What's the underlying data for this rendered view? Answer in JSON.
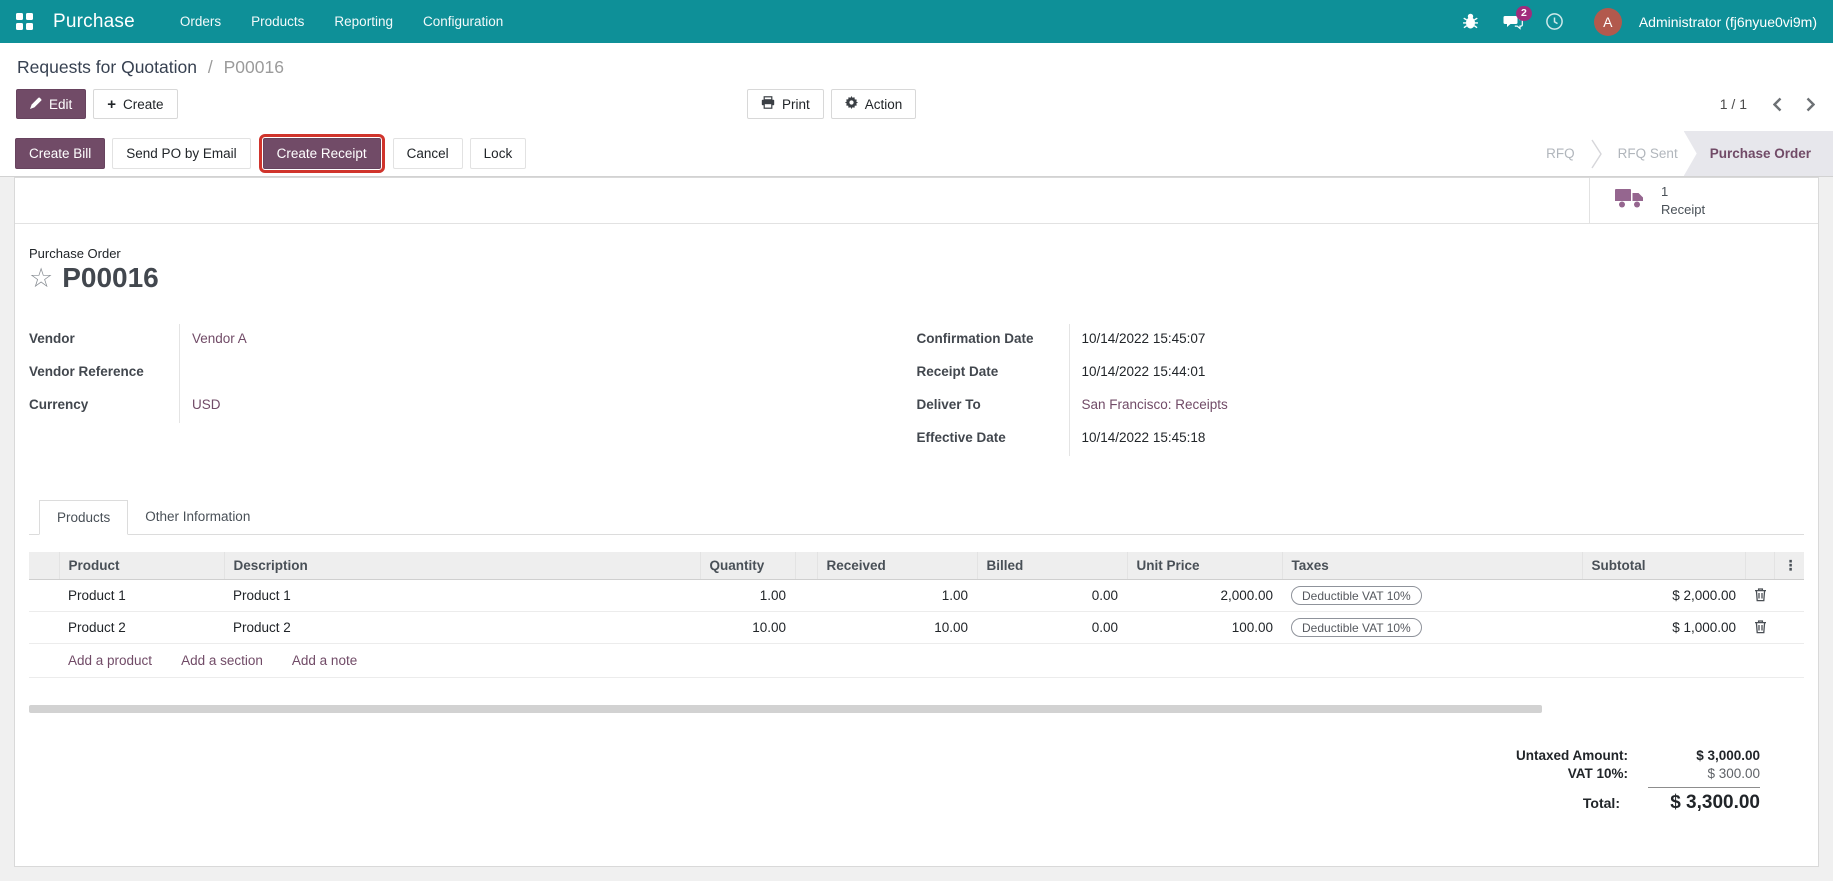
{
  "navbar": {
    "app_menu_label": "Purchase",
    "menus": [
      "Orders",
      "Products",
      "Reporting",
      "Configuration"
    ],
    "message_count": "2",
    "avatar_initial": "A",
    "user": "Administrator (fj6nyue0vi9m)"
  },
  "breadcrumb": {
    "parent": "Requests for Quotation",
    "separator": "/",
    "current": "P00016"
  },
  "actions": {
    "edit": "Edit",
    "create": "Create",
    "print": "Print",
    "action": "Action",
    "pager": "1 / 1"
  },
  "statusbar": {
    "buttons": [
      {
        "label": "Create Bill",
        "style": "primary"
      },
      {
        "label": "Send PO by Email",
        "style": "secondary"
      },
      {
        "label": "Create Receipt",
        "style": "primary",
        "highlighted": true
      },
      {
        "label": "Cancel",
        "style": "secondary"
      },
      {
        "label": "Lock",
        "style": "secondary"
      }
    ],
    "states": [
      {
        "label": "RFQ",
        "active": false
      },
      {
        "label": "RFQ Sent",
        "active": false
      },
      {
        "label": "Purchase Order",
        "active": true
      }
    ]
  },
  "smart_button": {
    "count": "1",
    "label": "Receipt"
  },
  "form": {
    "type_label": "Purchase Order",
    "name": "P00016",
    "left_fields": [
      {
        "label": "Vendor",
        "value": "Vendor A"
      },
      {
        "label": "Vendor Reference",
        "value": ""
      },
      {
        "label": "Currency",
        "value": "USD"
      }
    ],
    "right_fields": [
      {
        "label": "Confirmation Date",
        "value": "10/14/2022 15:45:07"
      },
      {
        "label": "Receipt Date",
        "value": "10/14/2022 15:44:01"
      },
      {
        "label": "Deliver To",
        "value": "San Francisco: Receipts"
      },
      {
        "label": "Effective Date",
        "value": "10/14/2022 15:45:18"
      }
    ]
  },
  "notebook": {
    "tabs": [
      {
        "label": "Products",
        "active": true
      },
      {
        "label": "Other Information",
        "active": false
      }
    ]
  },
  "products_table": {
    "columns": [
      "Product",
      "Description",
      "Quantity",
      "Received",
      "Billed",
      "Unit Price",
      "Taxes",
      "Subtotal"
    ],
    "options_icon": "⋮",
    "rows": [
      {
        "product": "Product 1",
        "description": "Product 1",
        "quantity": "1.00",
        "received": "1.00",
        "billed": "0.00",
        "unit_price": "2,000.00",
        "taxes": "Deductible VAT 10%",
        "subtotal": "$ 2,000.00"
      },
      {
        "product": "Product 2",
        "description": "Product 2",
        "quantity": "10.00",
        "received": "10.00",
        "billed": "0.00",
        "unit_price": "100.00",
        "taxes": "Deductible VAT 10%",
        "subtotal": "$ 1,000.00"
      }
    ],
    "footer_links": [
      "Add a product",
      "Add a section",
      "Add a note"
    ]
  },
  "totals": {
    "untaxed_label": "Untaxed Amount:",
    "untaxed_value": "$ 3,000.00",
    "tax_label": "VAT 10%:",
    "tax_value": "$ 300.00",
    "total_label": "Total:",
    "total_value": "$ 3,300.00"
  },
  "icons": {
    "apps": "grid",
    "bug": "bug",
    "messages": "chat-bubbles",
    "activities": "clock",
    "edit": "pencil",
    "create": "plus",
    "print": "printer",
    "action": "gear",
    "favorite": "star-outline",
    "receipt": "truck",
    "delete": "trash",
    "options": "vertical-dots"
  },
  "colors": {
    "navbar_teal": "#0e9098",
    "primary_purple": "#714B67",
    "highlight_red": "#d0342c",
    "link_purple": "#714B67",
    "badge_magenta": "#a02c7c",
    "avatar": "#b2594d",
    "page_background": "#f0f0f0"
  }
}
